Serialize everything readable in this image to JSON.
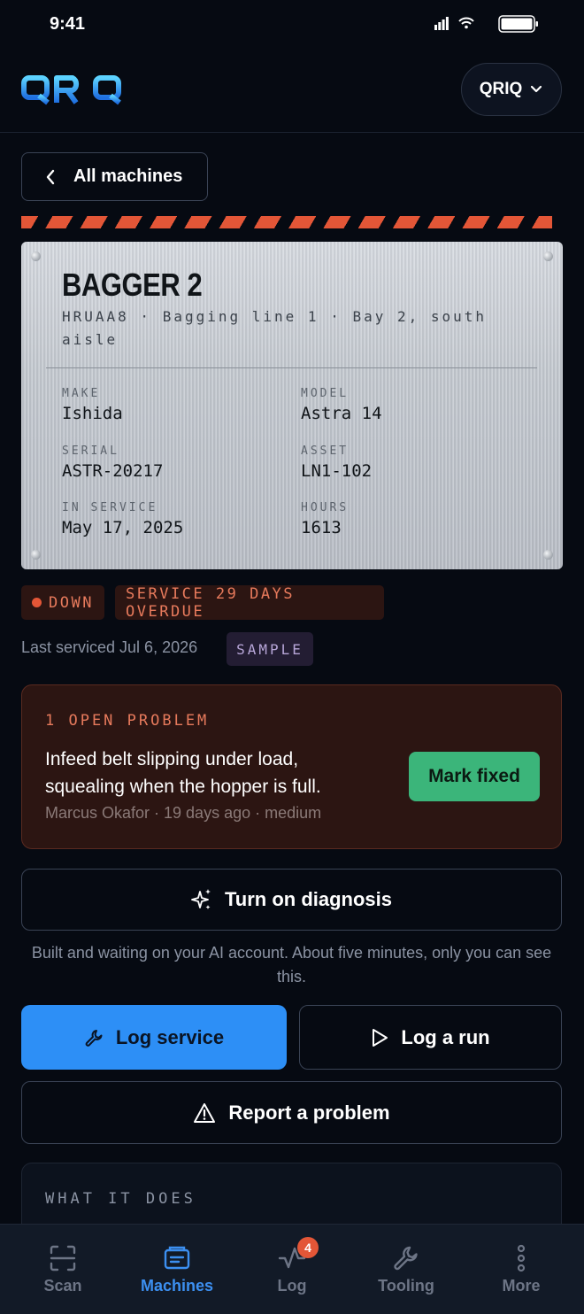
{
  "status_bar": {
    "time": "9:41"
  },
  "header": {
    "logo": "QRIQ",
    "org_label": "QRIQ"
  },
  "nav": {
    "back_label": "All machines"
  },
  "machine": {
    "name": "BAGGER 2",
    "subtitle": "HRUAA8 · Bagging line 1 · Bay 2, south aisle",
    "specs": [
      {
        "label": "MAKE",
        "value": "Ishida"
      },
      {
        "label": "MODEL",
        "value": "Astra 14"
      },
      {
        "label": "SERIAL",
        "value": "ASTR-20217"
      },
      {
        "label": "ASSET",
        "value": "LN1-102"
      },
      {
        "label": "IN SERVICE",
        "value": "May 17, 2025"
      },
      {
        "label": "HOURS",
        "value": "1613"
      }
    ]
  },
  "status": {
    "state": "DOWN",
    "service_badge": "SERVICE 29 DAYS OVERDUE",
    "last_serviced": "Last serviced Jul 6, 2026",
    "sample_tag": "SAMPLE"
  },
  "problem": {
    "heading": "1 OPEN PROBLEM",
    "description": "Infeed belt slipping under load, squealing when the hopper is full.",
    "meta": "Marcus Okafor · 19 days ago · medium",
    "action_label": "Mark fixed"
  },
  "diagnosis": {
    "button_label": "Turn on diagnosis",
    "note": "Built and waiting on your AI account. About five minutes, only you can see this."
  },
  "actions": {
    "log_service": "Log service",
    "log_run": "Log a run",
    "report_problem": "Report a problem"
  },
  "what_it_does": {
    "heading": "WHAT IT DOES"
  },
  "tabs": [
    {
      "label": "Scan",
      "icon": "scan-icon"
    },
    {
      "label": "Machines",
      "icon": "machines-icon",
      "active": true
    },
    {
      "label": "Log",
      "icon": "log-icon",
      "badge": "4"
    },
    {
      "label": "Tooling",
      "icon": "wrench-icon"
    },
    {
      "label": "More",
      "icon": "more-icon"
    }
  ],
  "colors": {
    "background": "#060a12",
    "accent_blue": "#2d8ff6",
    "alert_orange": "#e35637",
    "success_green": "#3bb57a",
    "sample_purple": "#b7a6d8"
  }
}
